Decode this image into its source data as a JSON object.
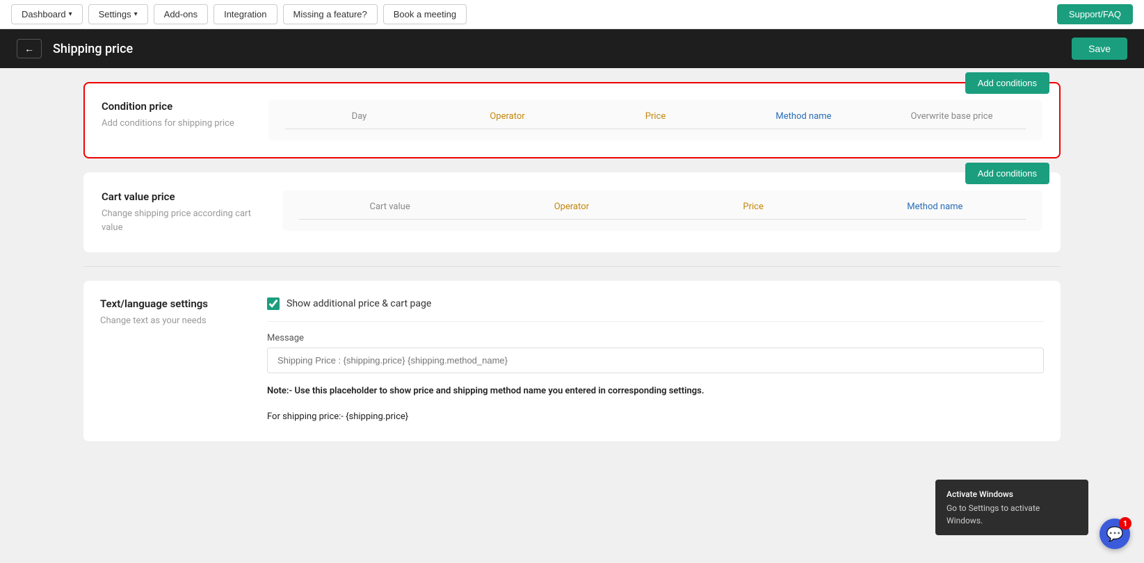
{
  "nav": {
    "dashboard_label": "Dashboard",
    "settings_label": "Settings",
    "addons_label": "Add-ons",
    "integration_label": "Integration",
    "missing_feature_label": "Missing a feature?",
    "book_meeting_label": "Book a meeting",
    "support_label": "Support/FAQ"
  },
  "header": {
    "title": "Shipping price",
    "save_label": "Save",
    "back_label": "←"
  },
  "condition_price": {
    "label": "Condition price",
    "description": "Add conditions for shipping price",
    "add_btn": "Add conditions",
    "table_headers": {
      "day": "Day",
      "operator": "Operator",
      "price": "Price",
      "method_name": "Method name",
      "overwrite_base_price": "Overwrite base price"
    }
  },
  "cart_value_price": {
    "label": "Cart value price",
    "description": "Change shipping price according cart value",
    "add_btn": "Add conditions",
    "table_headers": {
      "cart_value": "Cart value",
      "operator": "Operator",
      "price": "Price",
      "method_name": "Method name"
    }
  },
  "text_language_settings": {
    "label": "Text/language settings",
    "description": "Change text as your needs",
    "show_price_label": "Show additional price & cart page",
    "message_label": "Message",
    "message_placeholder": "Shipping Price : {shipping.price} {shipping.method_name}",
    "note_text": "Note:- Use this placeholder to show price and shipping method name you entered in corresponding settings.",
    "for_shipping_price": "For shipping price:- {shipping.price}"
  },
  "windows_overlay": {
    "title": "Activate Windows",
    "text": "Go to Settings to activate Windows."
  },
  "chat": {
    "badge": "1"
  }
}
